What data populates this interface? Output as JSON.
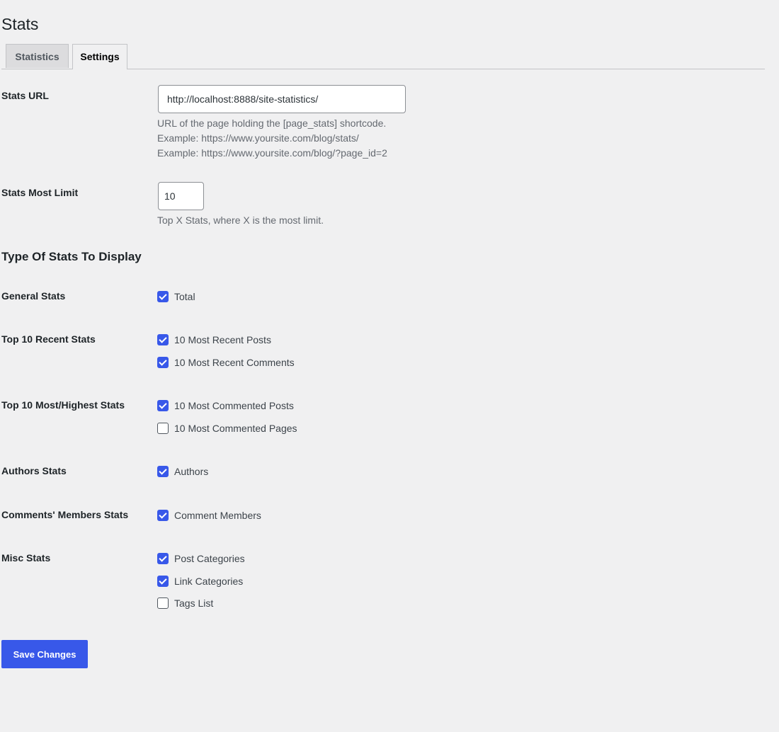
{
  "page": {
    "title": "Stats"
  },
  "tabs": [
    {
      "label": "Statistics",
      "active": false
    },
    {
      "label": "Settings",
      "active": true
    }
  ],
  "settings": {
    "stats_url": {
      "label": "Stats URL",
      "value": "http://localhost:8888/site-statistics/",
      "desc_lines": [
        "URL of the page holding the [page_stats] shortcode.",
        "Example: https://www.yoursite.com/blog/stats/",
        "Example: https://www.yoursite.com/blog/?page_id=2"
      ]
    },
    "most_limit": {
      "label": "Stats Most Limit",
      "value": "10",
      "desc": "Top X Stats, where X is the most limit."
    }
  },
  "section": {
    "title": "Type Of Stats To Display"
  },
  "groups": [
    {
      "label": "General Stats",
      "options": [
        {
          "label": "Total",
          "checked": true
        }
      ]
    },
    {
      "label": "Top 10 Recent Stats",
      "options": [
        {
          "label": "10 Most Recent Posts",
          "checked": true
        },
        {
          "label": "10 Most Recent Comments",
          "checked": true
        }
      ]
    },
    {
      "label": "Top 10 Most/Highest Stats",
      "options": [
        {
          "label": "10 Most Commented Posts",
          "checked": true
        },
        {
          "label": "10 Most Commented Pages",
          "checked": false
        }
      ]
    },
    {
      "label": "Authors Stats",
      "options": [
        {
          "label": "Authors",
          "checked": true
        }
      ]
    },
    {
      "label": "Comments' Members Stats",
      "options": [
        {
          "label": "Comment Members",
          "checked": true
        }
      ]
    },
    {
      "label": "Misc Stats",
      "options": [
        {
          "label": "Post Categories",
          "checked": true
        },
        {
          "label": "Link Categories",
          "checked": true
        },
        {
          "label": "Tags List",
          "checked": false
        }
      ]
    }
  ],
  "actions": {
    "save_label": "Save Changes"
  },
  "colors": {
    "accent": "#3858e9",
    "background": "#f0f0f1"
  }
}
